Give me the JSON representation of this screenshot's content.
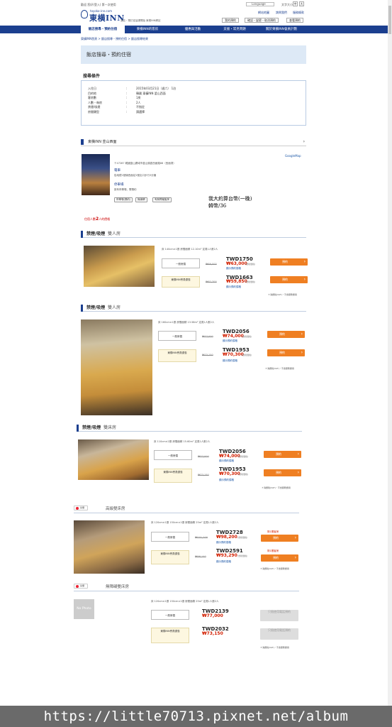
{
  "header": {
    "welcome": "歡迎 您好(登入) 第一次使用",
    "logo_sub": "toyoko-inn.com",
    "logo_main": "東横INN",
    "slogan": "酒店・預訂從這裡開始 東橫INN網站",
    "language": "Language",
    "font_size": "文字大小",
    "font_btns": [
      "中",
      "大"
    ],
    "top_links": [
      "網站地圖",
      "詢問我們",
      "服務條款"
    ],
    "buttons": [
      "我的預約",
      "確認・變更・取消預約",
      "查看預約"
    ]
  },
  "nav": {
    "tabs": [
      "飯店搜尋・預約住宿",
      "東橫INN的客房",
      "優惠與活動",
      "支援・常見問題",
      "關於東橫INN會員計劃"
    ]
  },
  "breadcrumb": "東橫INN首頁 > 飯店搜尋・預約住宿 > 飯店搜尋結果",
  "page_title": "飯店搜尋・預約住宿",
  "conditions": {
    "heading": "搜尋條件",
    "rows": [
      {
        "k": "入住日",
        "v": "2015年03月21日（週六） 1泊"
      },
      {
        "k": "目的地",
        "v": "韓國 東橫INN 釜山西面"
      },
      {
        "k": "客房數",
        "v": "1房"
      },
      {
        "k": "人數・每房",
        "v": "2人"
      },
      {
        "k": "禁煙/吸煙",
        "v": "不指定"
      },
      {
        "k": "房間類型",
        "v": "請選擇"
      }
    ]
  },
  "hotel": {
    "name": "東橫INN 釜山西面",
    "map_link": "GoogleMap",
    "address": "〒47287 韓國釜山廣域市釜山鎮區西面路88（西面洞）",
    "access_label": "電車",
    "access_text": "從地鐵1號線西面站1號出口步行3分鐘",
    "parking_label": "停車場",
    "parking_text": "設有停車場，需預約",
    "tags": [
      "停車場(預約)",
      "無線網",
      "有無障礙客房"
    ]
  },
  "handwriting": {
    "line1": "我大約算台幣(一晚)",
    "line2": "韓幣/36"
  },
  "room_note": {
    "pre": "住宿人數",
    "num": "2",
    "post": "人的價格"
  },
  "rooms": [
    {
      "name": "禁煙/吸煙",
      "subname": "雙人房",
      "desc": "床 140cm×1張 房間面積 12.10m² 定員1人數2人",
      "plans": [
        {
          "label": "一般房價",
          "old": "₩69,000",
          "twd": "TWD1750",
          "won": "₩63,000",
          "tax": "(含稅價格)",
          "detail": "顯示預約價格",
          "book": "預約"
        },
        {
          "label": "東橫INN會員優惠",
          "old": "₩62,700",
          "twd": "TWD1663",
          "won": "₩59,850",
          "tax": "(含稅價格)",
          "detail": "顯示預約價格",
          "book": "預約"
        }
      ],
      "note": "＊消費稅(VAT)・不含服務費用"
    },
    {
      "name": "禁煙/吸煙",
      "subname": "雙人房",
      "desc": "床 160cm×1張 房間面積 13.58m² 定員1人數2人",
      "plans": [
        {
          "label": "一般房價",
          "old": "₩77,000",
          "twd": "TWD2056",
          "won": "₩74,000",
          "tax": "(含稅價格)",
          "detail": "顯示預約價格",
          "book": "預約"
        },
        {
          "label": "東橫INN會員優惠",
          "old": "₩73,150",
          "twd": "TWD1953",
          "won": "₩70,300",
          "tax": "(含稅價格)",
          "detail": "顯示預約價格",
          "book": "預約"
        }
      ],
      "note": "＊消費稅(VAT)・不含服務費用"
    },
    {
      "name": "禁煙/吸煙",
      "subname": "雙床房",
      "desc": "床 110cm×2張 房間面積 15.60m² 定員1人數2人",
      "plans": [
        {
          "label": "一般房價",
          "old": "₩77,000",
          "twd": "TWD2056",
          "won": "₩74,000",
          "tax": "(含稅價格)",
          "detail": "顯示預約價格",
          "book": "預約"
        },
        {
          "label": "東橫INN會員優惠",
          "old": "₩73,150",
          "twd": "TWD1953",
          "won": "₩70,300",
          "tax": "(含稅價格)",
          "detail": "顯示預約價格",
          "book": "預約"
        }
      ],
      "note": "＊消費稅(VAT)・不含服務費用"
    },
    {
      "badge": "禁煙",
      "name": "高級雙床房",
      "subname": "",
      "desc": "床 120cm×1張 150cm×1張 房間面積 25m² 定員1人數2人",
      "plans": [
        {
          "label": "一般房價",
          "old": "₩101,200",
          "twd": "TWD2728",
          "won": "₩98,200",
          "tax": "(含稅價格)",
          "detail": "顯示預約價格",
          "book": "預約",
          "remain": "剩1間客房"
        },
        {
          "label": "東橫INN會員優惠",
          "old": "₩96,140",
          "twd": "TWD2591",
          "won": "₩93,290",
          "tax": "(含稅價格)",
          "detail": "顯示預約價格",
          "book": "預約",
          "remain": "剩1間客房"
        }
      ],
      "note": "＊消費稅(VAT)・不含服務費用"
    },
    {
      "badge": "禁煙",
      "name": "無障礙雙床房",
      "subname": "",
      "nophoto": "No Photo",
      "desc": "床 120cm×1張 150cm×1張 房間面積 25m² 定員1人數2人",
      "plans": [
        {
          "label": "一般房價",
          "twd": "TWD2139",
          "won": "₩77,000",
          "book": "只限使用電話預約"
        },
        {
          "label": "東橫INN會員優惠",
          "twd": "TWD2032",
          "won": "₩73,150",
          "book": "只限使用電話預約"
        }
      ],
      "note": "＊消費稅(VAT)・不含服務費用"
    }
  ],
  "watermark": "https://little70713.pixnet.net/album"
}
